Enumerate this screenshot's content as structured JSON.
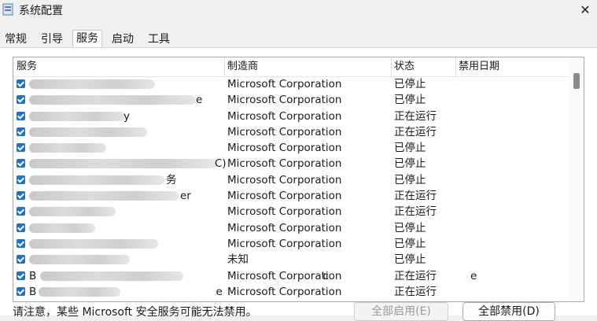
{
  "window": {
    "title": "系统配置",
    "close_glyph": "✕"
  },
  "tabs": [
    {
      "label": "常规"
    },
    {
      "label": "引导"
    },
    {
      "label": "服务"
    },
    {
      "label": "启动"
    },
    {
      "label": "工具"
    }
  ],
  "columns": {
    "service": "服务",
    "manufacturer": "制造商",
    "status": "状态",
    "disabled_date": "禁用日期"
  },
  "rows": [
    {
      "service": "",
      "manufacturer": "Microsoft Corporation",
      "status": "已停止",
      "checked": true
    },
    {
      "service": "e",
      "manufacturer": "Microsoft Corporation",
      "status": "已停止",
      "checked": true
    },
    {
      "service": "y",
      "manufacturer": "Microsoft Corporation",
      "status": "正在运行",
      "checked": true
    },
    {
      "service": "",
      "manufacturer": "Microsoft Corporation",
      "status": "正在运行",
      "checked": true
    },
    {
      "service": "",
      "manufacturer": "Microsoft Corporation",
      "status": "已停止",
      "checked": true
    },
    {
      "service": "C)",
      "manufacturer": "Microsoft Corporation",
      "status": "已停止",
      "checked": true
    },
    {
      "service": "务",
      "manufacturer": "Microsoft Corporation",
      "status": "已停止",
      "checked": true
    },
    {
      "service": "er",
      "manufacturer": "Microsoft Corporation",
      "status": "正在运行",
      "checked": true
    },
    {
      "service": "",
      "manufacturer": "Microsoft Corporation",
      "status": "正在运行",
      "checked": true
    },
    {
      "service": "",
      "manufacturer": "Microsoft Corporation",
      "status": "已停止",
      "checked": true
    },
    {
      "service": "",
      "manufacturer": "Microsoft Corporation",
      "status": "已停止",
      "checked": true
    },
    {
      "service": "",
      "manufacturer": "未知",
      "status": "已停止",
      "checked": true
    },
    {
      "service": "B ce",
      "manufacturer": "Microsoft Corporation",
      "status": "正在运行",
      "checked": true
    },
    {
      "service": "B e",
      "manufacturer": "Microsoft Corporation",
      "status": "正在运行",
      "checked": true
    }
  ],
  "footer": {
    "note": "请注意，某些 Microsoft 安全服务可能无法禁用。",
    "enable_all": "全部启用(E)",
    "disable_all": "全部禁用(D)"
  }
}
